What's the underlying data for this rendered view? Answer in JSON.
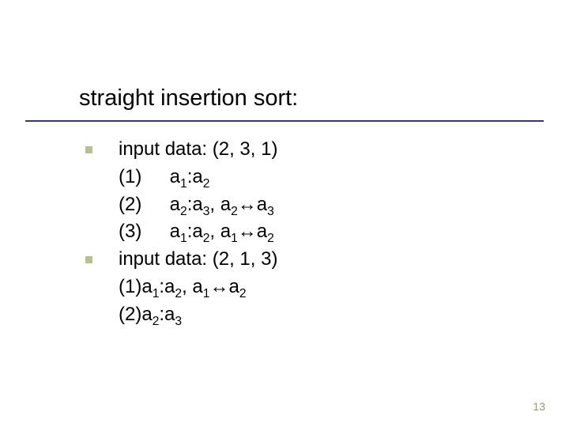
{
  "title": "straight insertion sort:",
  "bullet1": {
    "header": "input data: (2, 3, 1)",
    "steps": [
      {
        "num": "(1)",
        "text_html": "a<sub>1</sub>:a<sub>2</sub>"
      },
      {
        "num": "(2)",
        "text_html": "a<sub>2</sub>:a<sub>3</sub>, a<sub>2</sub><span class='arrow'>↔</span>a<sub>3</sub>"
      },
      {
        "num": "(3)",
        "text_html": "a<sub>1</sub>:a<sub>2</sub>, a<sub>1</sub><span class='arrow'>↔</span>a<sub>2</sub>"
      }
    ]
  },
  "bullet2": {
    "header": "input data: (2, 1, 3)",
    "steps": [
      {
        "num": "(1)",
        "text_html": "a<sub>1</sub>:a<sub>2</sub>, a<sub>1</sub><span class='arrow'>↔</span>a<sub>2</sub>"
      },
      {
        "num": "(2)",
        "text_html": "a<sub>2</sub>:a<sub>3</sub>"
      }
    ]
  },
  "page_number": "13"
}
